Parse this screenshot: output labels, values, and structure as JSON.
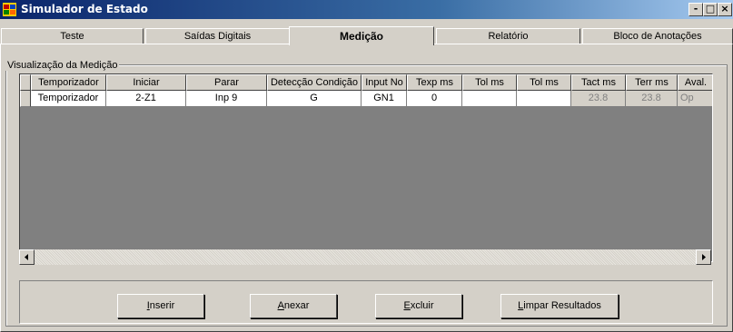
{
  "window": {
    "title": "Simulador de Estado",
    "buttons": [
      "-",
      "□",
      "×"
    ]
  },
  "tabs": [
    {
      "label": "Teste",
      "active": false
    },
    {
      "label": "Saídas Digitais",
      "active": false
    },
    {
      "label": "Medição",
      "active": true
    },
    {
      "label": "Relatório",
      "active": false
    },
    {
      "label": "Bloco de Anotações",
      "active": false
    }
  ],
  "group": {
    "label": "Visualização da Medição"
  },
  "table": {
    "headers": [
      "Temporizador",
      "Iniciar",
      "Parar",
      "Detecção Condição",
      "Input No",
      "Texp ms",
      "Tol ms",
      "Tol ms",
      "Tact ms",
      "Terr ms",
      "Aval."
    ],
    "rows": [
      [
        "Temporizador",
        "2-Z1",
        "Inp 9",
        "G",
        "GN1",
        "0",
        "",
        "",
        "23.8",
        "23.8",
        "Op"
      ]
    ]
  },
  "buttons": {
    "inserir": {
      "mnemonic": "I",
      "rest": "nserir"
    },
    "anexar": {
      "mnemonic": "A",
      "rest": "nexar"
    },
    "excluir": {
      "mnemonic": "E",
      "rest": "xcluir"
    },
    "limpar": {
      "mnemonic": "L",
      "rest": "impar Resultados"
    }
  }
}
